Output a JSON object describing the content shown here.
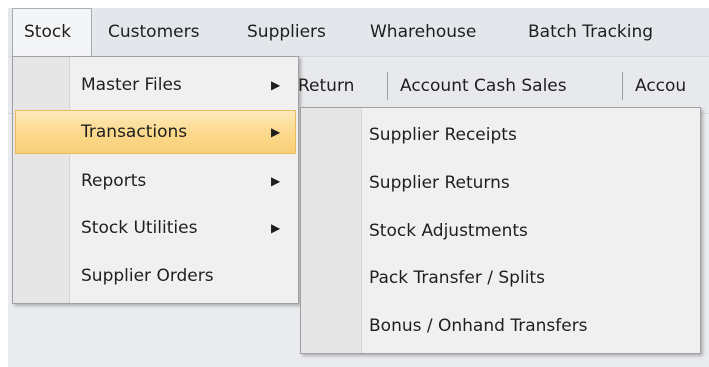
{
  "menubar": {
    "items": [
      "Stock",
      "Customers",
      "Suppliers",
      "Wharehouse",
      "Batch Tracking"
    ]
  },
  "toolbar": {
    "items": [
      "Return",
      "Account Cash Sales",
      "Accou"
    ]
  },
  "stock_menu": {
    "items": [
      {
        "label": "Master Files",
        "submenu_arrow": "▶"
      },
      {
        "label": "Transactions",
        "submenu_arrow": "▶"
      },
      {
        "label": "Reports",
        "submenu_arrow": "▶"
      },
      {
        "label": "Stock Utilities",
        "submenu_arrow": "▶"
      },
      {
        "label": "Supplier Orders",
        "submenu_arrow": ""
      }
    ],
    "highlighted": "Transactions"
  },
  "transactions_menu": {
    "items": [
      "Supplier Receipts",
      "Supplier Returns",
      "Stock Adjustments",
      "Pack Transfer / Splits",
      "Bonus / Onhand Transfers"
    ]
  },
  "colors": {
    "highlight_top": "#fdeabb",
    "highlight_bottom": "#f9d07a",
    "menu_bg": "#f0f0f0",
    "menubar_bg": "#e3e6ea"
  }
}
